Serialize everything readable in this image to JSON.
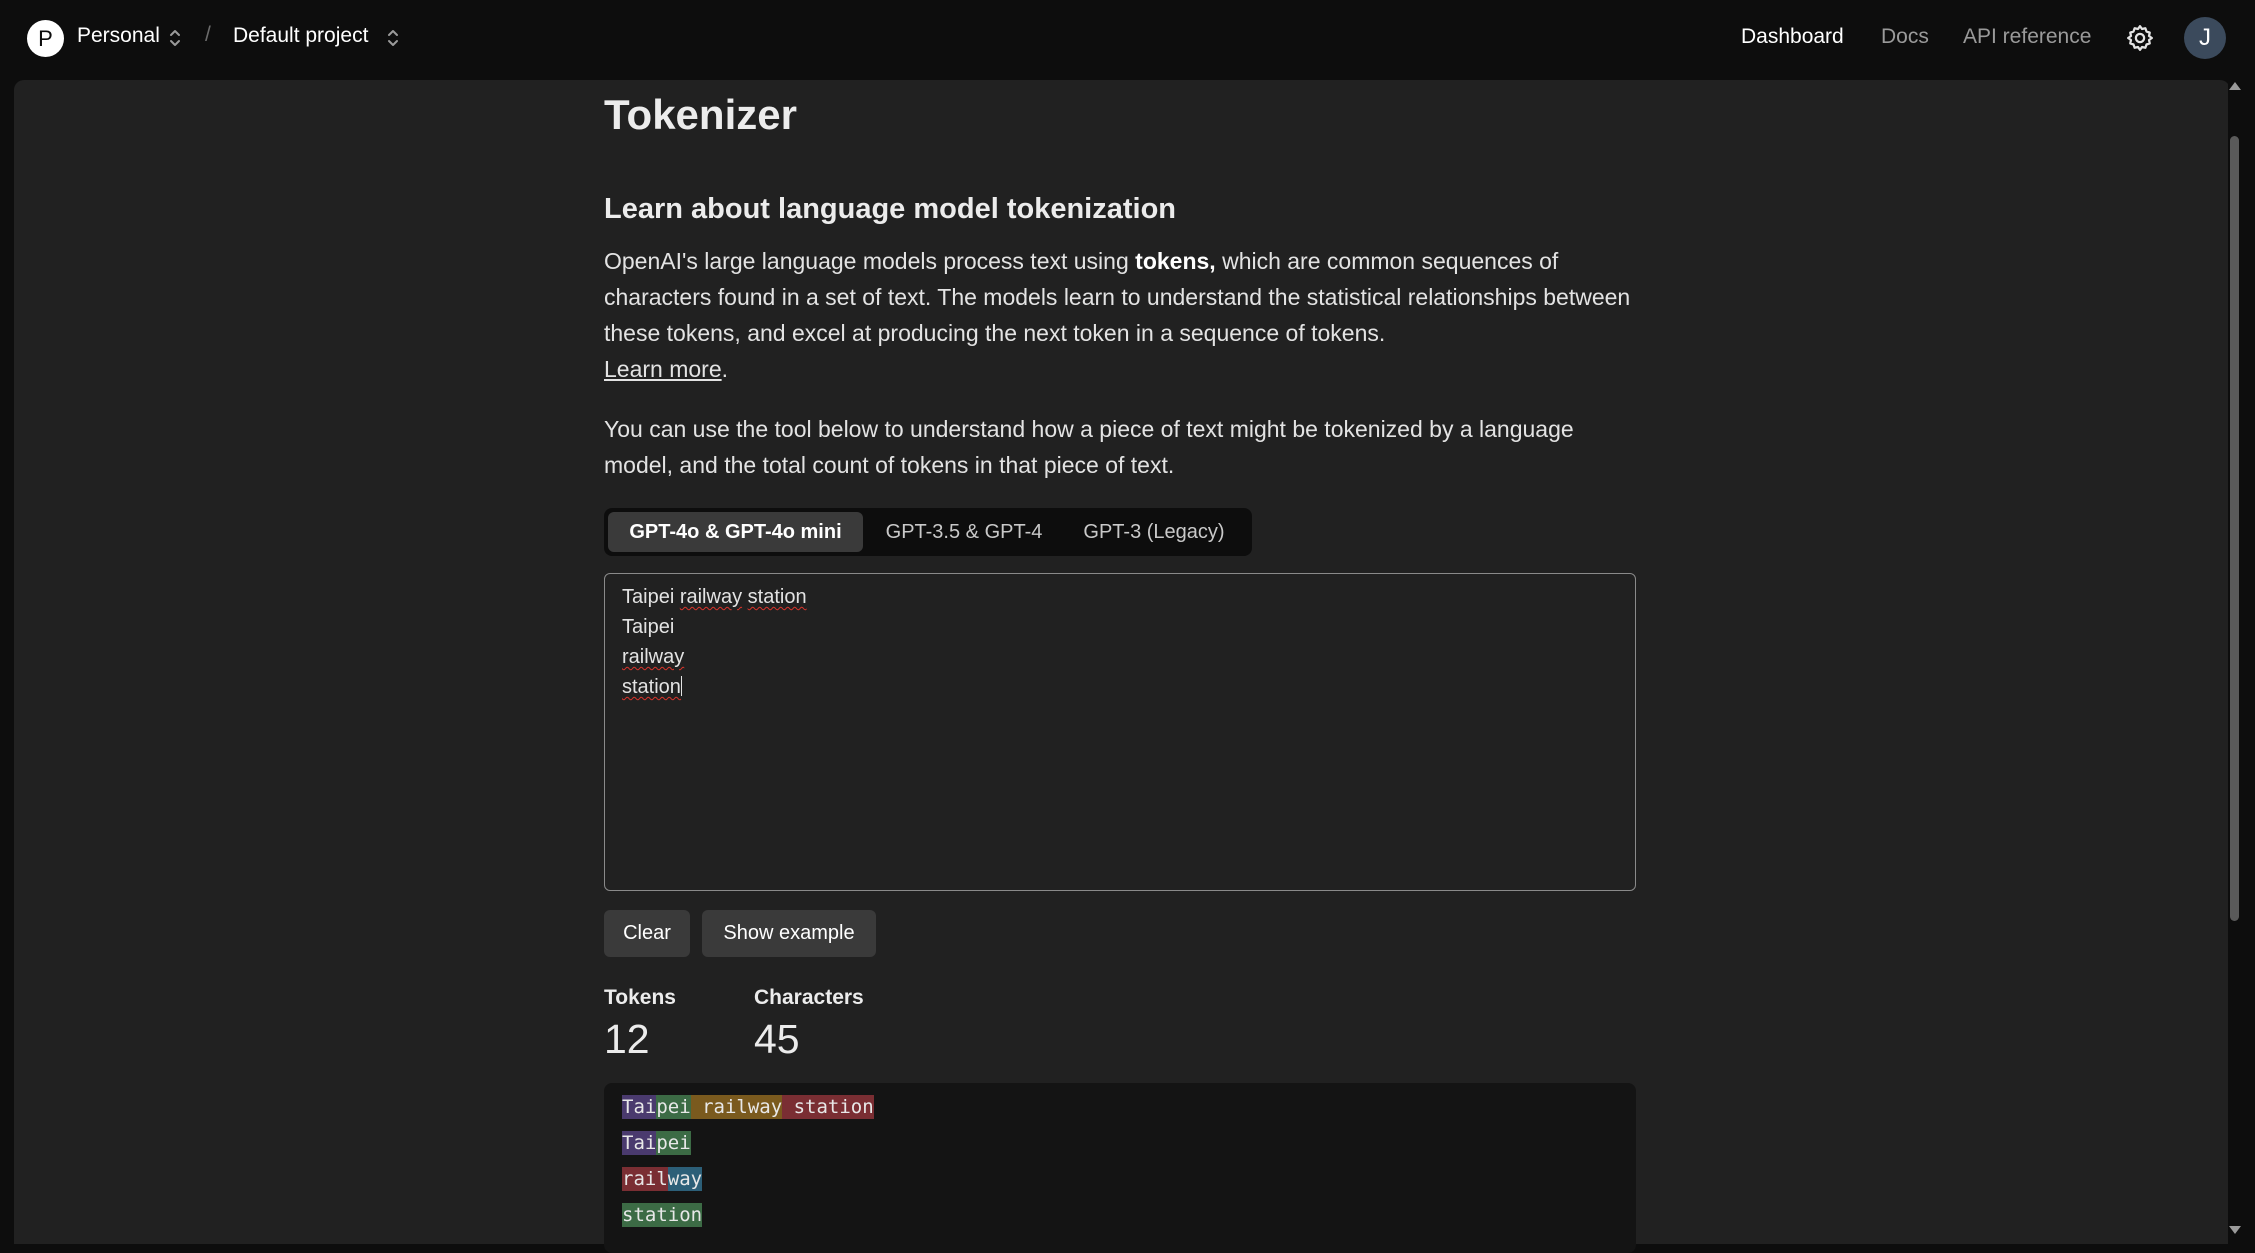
{
  "topbar": {
    "org_initial": "P",
    "org_name": "Personal",
    "separator": "/",
    "project_name": "Default project",
    "nav": [
      {
        "label": "Dashboard",
        "active": true
      },
      {
        "label": "Docs",
        "active": false
      },
      {
        "label": "API reference",
        "active": false
      }
    ],
    "user_initial": "J"
  },
  "page": {
    "title": "Tokenizer",
    "subtitle": "Learn about language model tokenization",
    "intro_before": "OpenAI's large language models process text using ",
    "intro_bold": "tokens,",
    "intro_after": " which are common sequences of characters found in a set of text. The models learn to understand the statistical relationships between these tokens, and excel at producing the next token in a sequence of tokens.",
    "learn_more": "Learn more",
    "learn_more_suffix": ".",
    "tool_desc": "You can use the tool below to understand how a piece of text might be tokenized by a language model, and the total count of tokens in that piece of text."
  },
  "tabs": [
    {
      "label": "GPT-4o & GPT-4o mini",
      "active": true
    },
    {
      "label": "GPT-3.5 & GPT-4",
      "active": false
    },
    {
      "label": "GPT-3 (Legacy)",
      "active": false
    }
  ],
  "input": {
    "lines": [
      "Taipei railway station",
      "Taipei",
      "railway",
      "station"
    ]
  },
  "buttons": {
    "clear": "Clear",
    "show_example": "Show example"
  },
  "stats": {
    "tokens_label": "Tokens",
    "tokens_value": "12",
    "chars_label": "Characters",
    "chars_value": "45"
  },
  "token_colors": [
    "#4a3a6e",
    "#3c6b45",
    "#7a5a1e",
    "#7a2e33",
    "#2c5f78"
  ],
  "tokens_output": [
    [
      {
        "t": "Tai",
        "c": 0
      },
      {
        "t": "pei",
        "c": 1
      },
      {
        "t": " railway",
        "c": 2
      },
      {
        "t": " station",
        "c": 3
      }
    ],
    [
      {
        "t": "Tai",
        "c": 0
      },
      {
        "t": "pei",
        "c": 1
      }
    ],
    [
      {
        "t": "rail",
        "c": 3
      },
      {
        "t": "way",
        "c": 4
      }
    ],
    [
      {
        "t": "station",
        "c": 1
      }
    ]
  ]
}
